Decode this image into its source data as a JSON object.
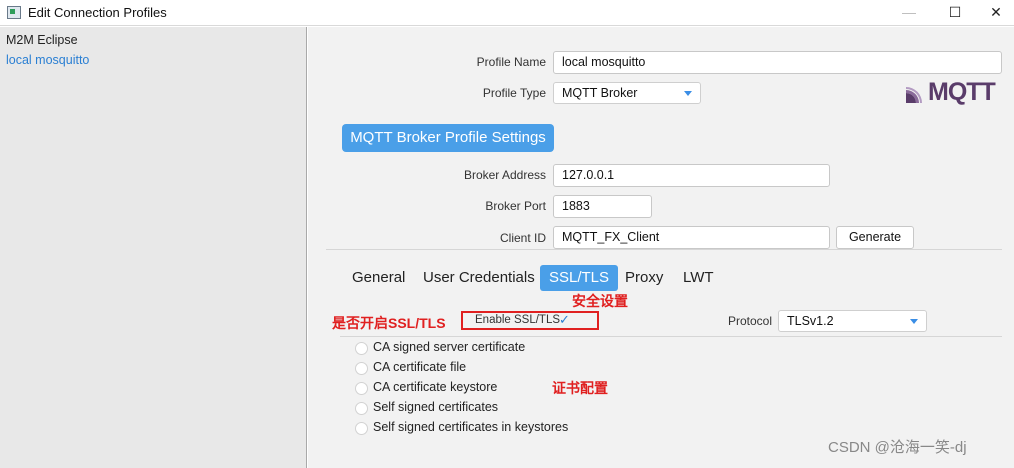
{
  "window": {
    "title": "Edit Connection Profiles",
    "min_glyph": "—",
    "max_glyph": "☐",
    "close_glyph": "✕"
  },
  "sidebar": {
    "items": [
      {
        "label": "M2M Eclipse"
      },
      {
        "label": "local mosquitto"
      }
    ]
  },
  "profile": {
    "name_label": "Profile Name",
    "name_value": "local mosquitto",
    "type_label": "Profile Type",
    "type_value": "MQTT Broker"
  },
  "logo": {
    "text": "MQTT",
    "icon": "mqtt-logo-icon"
  },
  "broker": {
    "section_title": "MQTT Broker Profile Settings",
    "address_label": "Broker Address",
    "address_value": "127.0.0.1",
    "port_label": "Broker Port",
    "port_value": "1883",
    "client_id_label": "Client ID",
    "client_id_value": "MQTT_FX_Client",
    "generate_label": "Generate"
  },
  "tabs": [
    {
      "label": "General"
    },
    {
      "label": "User Credentials"
    },
    {
      "label": "SSL/TLS"
    },
    {
      "label": "Proxy"
    },
    {
      "label": "LWT"
    }
  ],
  "ssl": {
    "enable_label": "Enable SSL/TLS",
    "enable_checked": true,
    "check_glyph": "✓",
    "protocol_label": "Protocol",
    "protocol_value": "TLSv1.2",
    "options": [
      {
        "label": "CA signed server certificate"
      },
      {
        "label": "CA certificate file"
      },
      {
        "label": "CA certificate keystore"
      },
      {
        "label": "Self signed certificates"
      },
      {
        "label": "Self signed certificates in keystores"
      }
    ]
  },
  "annotations": {
    "security_settings": "安全设置",
    "enable_ssl_question": "是否开启SSL/TLS",
    "cert_config": "证书配置"
  },
  "watermark": "CSDN @沧海一笑-dj",
  "colors": {
    "accent": "#4a9fe8",
    "annotation_red": "#e02020",
    "link_blue": "#2a7fd3"
  }
}
